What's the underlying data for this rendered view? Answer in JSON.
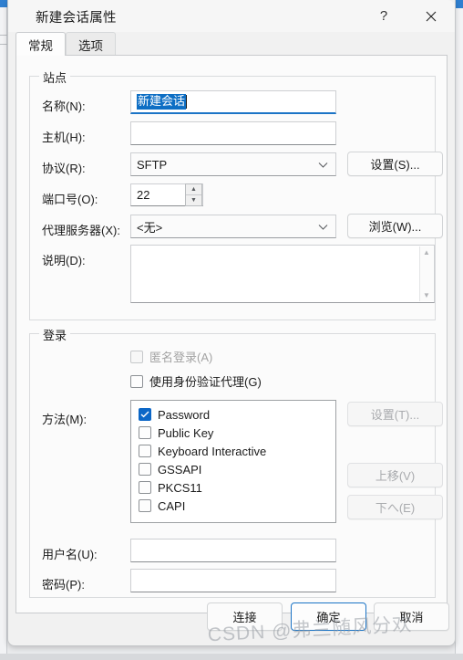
{
  "window": {
    "title": "新建会话属性",
    "help_icon": "question-mark-icon",
    "close_icon": "close-icon"
  },
  "tabs": [
    {
      "label": "常规",
      "active": true
    },
    {
      "label": "选项",
      "active": false
    }
  ],
  "site_group": {
    "legend": "站点",
    "name_label": "名称(N):",
    "name_value": "新建会话",
    "host_label": "主机(H):",
    "host_value": "",
    "protocol_label": "协议(R):",
    "protocol_value": "SFTP",
    "protocol_settings_button": "设置(S)...",
    "port_label": "端口号(O):",
    "port_value": "22",
    "proxy_label": "代理服务器(X):",
    "proxy_value": "<无>",
    "proxy_browse_button": "浏览(W)...",
    "description_label": "说明(D):",
    "description_value": ""
  },
  "login_group": {
    "legend": "登录",
    "anonymous_label": "匿名登录(A)",
    "anonymous_checked": false,
    "anonymous_disabled": true,
    "auth_agent_label": "使用身份验证代理(G)",
    "auth_agent_checked": false,
    "method_label": "方法(M):",
    "methods": [
      {
        "label": "Password",
        "checked": true
      },
      {
        "label": "Public Key",
        "checked": false
      },
      {
        "label": "Keyboard Interactive",
        "checked": false
      },
      {
        "label": "GSSAPI",
        "checked": false
      },
      {
        "label": "PKCS11",
        "checked": false
      },
      {
        "label": "CAPI",
        "checked": false
      }
    ],
    "method_settings_button": "设置(T)...",
    "move_up_button": "上移(V)",
    "move_down_button": "下へ(E)",
    "username_label": "用户名(U):",
    "username_value": "",
    "password_label": "密码(P):",
    "password_value": ""
  },
  "footer": {
    "connect_button": "连接",
    "ok_button": "确定",
    "cancel_button": "取消"
  },
  "watermark": "CSDN @弗兰随风分欢",
  "colors": {
    "accent": "#0c67c7",
    "selection": "#0d6ec4",
    "dialog_bg": "#f1f1f1",
    "page_bg": "#fbfbfb"
  }
}
